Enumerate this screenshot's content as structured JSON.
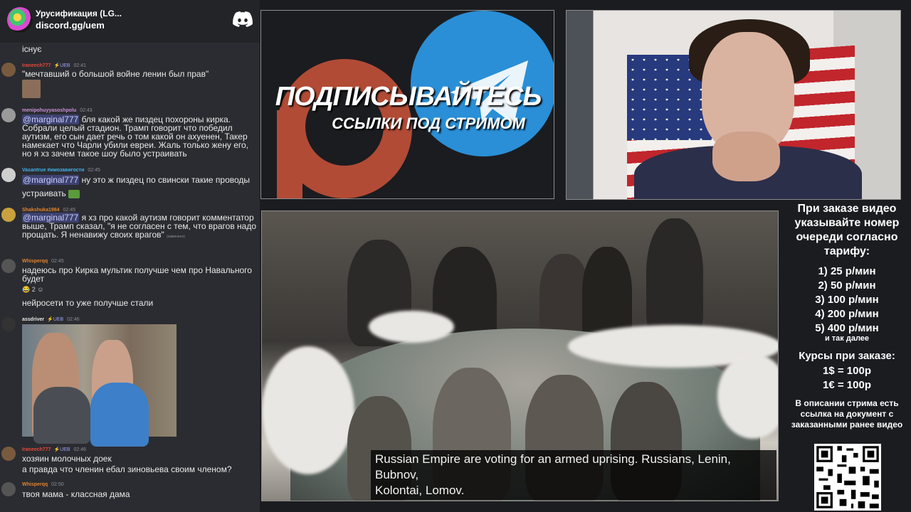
{
  "chat": {
    "server_name": "Урусификация (LG...",
    "server_link": "discord.gg/uem",
    "messages": [
      {
        "text_pre": "існує"
      },
      {
        "user": "Iraneech777",
        "badge": "⚡UEB",
        "time": "02:41",
        "user_color": "#e04a3a",
        "text": "\"мечтавший о большой войне ленин был прав\""
      },
      {
        "user": "menipohuyyasoshpolu",
        "badge": "",
        "time": "02:43",
        "user_color": "#c98fd8",
        "mention": "@marginal777",
        "text": " бля какой же пиздец похороны кирка. Собрали целый стадион. Трамп говорит что победил аутизм, его сын дает речь о том какой он ахуенен, Такер намекает что Чарли убили евреи. Жаль только жену его, но я хз зачем такое шоу было устраивать"
      },
      {
        "user": "Vasantrue #имозавигости",
        "badge": "",
        "time": "02:45",
        "user_color": "#3fb2e8",
        "mention": "@marginal777",
        "text": " ну это ж пиздец по свински такие проводы устраивать"
      },
      {
        "user": "Shakshuka1984",
        "badge": "",
        "time": "02:45",
        "user_color": "#e0832f",
        "mention": "@marginal777",
        "text": " я хз про какой аутизм говорит комментатор выше, Трамп сказал, \"я не согласен с тем, что врагов надо прощать. Я ненавижу своих врагов\"",
        "edited": "(изменено)"
      },
      {
        "user": "Whisperqq",
        "badge": "",
        "time": "02:45",
        "user_color": "#e0832f",
        "text": "надеюсь про Кирка мультик получше чем про Навального будет",
        "reaction_count": "2",
        "text2": "нейросети то уже получше стали"
      },
      {
        "user": "assdriver",
        "badge": "⚡UEB",
        "time": "02:46",
        "user_color": "#e8e8e8"
      },
      {
        "user": "Iraneech777",
        "badge": "⚡UEB",
        "time": "02:46",
        "user_color": "#e04a3a",
        "text": "хозяин молочных доек",
        "text2": "а правда что членин ебал зиновьева своим членом?"
      },
      {
        "user": "Whisperqq",
        "badge": "",
        "time": "02:50",
        "user_color": "#e0832f",
        "text": "твоя мама - классная дама"
      }
    ]
  },
  "promo": {
    "title": "ПОДПИСЫВАЙТЕСЬ",
    "subtitle": "ССЫЛКИ ПОД СТРИМОМ"
  },
  "video": {
    "subtitle_lines": [
      "Russian Empire are voting for an armed uprising. Russians, Lenin,",
      "Bubnov,",
      "Kolontai, Lomov."
    ]
  },
  "info": {
    "title": "При заказе видео указывайте номер очереди согласно тарифу:",
    "prices": [
      "1) 25 р/мин",
      "2) 50 р/мин",
      "3) 100 р/мин",
      "4) 200 р/мин",
      "5) 400 р/мин"
    ],
    "more": "и так далее",
    "rates_title": "Курсы при заказе:",
    "rates": [
      "1$ = 100р",
      "1€ = 100р"
    ],
    "description": "В описании стрима есть ссылка на документ с заказанными ранее видео"
  },
  "colors": {
    "mention_bg": "#3d4270",
    "discord_blurple": "#ffffff",
    "patreon": "#b14b35",
    "telegram": "#2a8fd6"
  }
}
